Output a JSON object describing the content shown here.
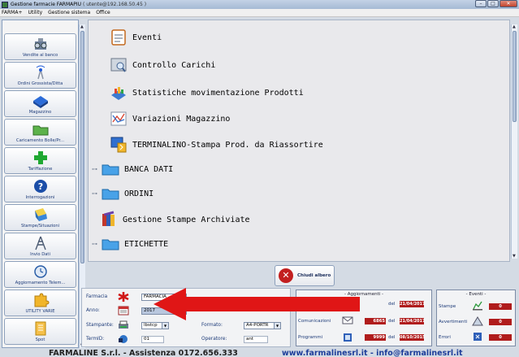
{
  "window": {
    "title": "Gestione farmacie FARMAPIU",
    "title_user": "( utente@192.168.50.45 )",
    "controls": [
      "–",
      "□",
      "✕"
    ]
  },
  "menubar": [
    "FARMA+",
    "Utility",
    "Gestione sistema",
    "Office"
  ],
  "sidebar": {
    "items": [
      {
        "label": "Vendite al banco",
        "icon": "cash-register-icon"
      },
      {
        "label": "Ordini Grossista/Ditta",
        "icon": "wifi-tower-icon"
      },
      {
        "label": "Magazzino",
        "icon": "warehouse-icon"
      },
      {
        "label": "Caricamento Bolle/Pr...",
        "icon": "folder-icon"
      },
      {
        "label": "Tariffazione",
        "icon": "green-cross-icon"
      },
      {
        "label": "Interrogazioni",
        "icon": "question-icon"
      },
      {
        "label": "Stampe/Situazioni",
        "icon": "printer-icon"
      },
      {
        "label": "Invio Dati",
        "icon": "antenna-icon"
      },
      {
        "label": "Aggiornamento Telem...",
        "icon": "clock-icon"
      },
      {
        "label": "UTILITY VARIE",
        "icon": "puzzle-icon"
      },
      {
        "label": "Spot",
        "icon": "document-icon"
      }
    ]
  },
  "tree": {
    "items": [
      {
        "label": "Eventi",
        "icon": "notepad-icon",
        "level": 1
      },
      {
        "label": "Controllo Carichi",
        "icon": "search-document-icon",
        "level": 1
      },
      {
        "label": "Statistiche movimentazione Prodotti",
        "icon": "stats-icon",
        "level": 1
      },
      {
        "label": "Variazioni Magazzino",
        "icon": "chart-line-icon",
        "level": 1
      },
      {
        "label": "TERMINALINO-Stampa Prod. da Riassortire",
        "icon": "terminal-icon",
        "level": 1
      },
      {
        "label": "BANCA DATI",
        "icon": "folder-icon",
        "level": 0
      },
      {
        "label": "ORDINI",
        "icon": "folder-icon",
        "level": 0
      },
      {
        "label": "Gestione Stampe Archiviate",
        "icon": "books-icon",
        "level": 0
      },
      {
        "label": "ETICHETTE",
        "icon": "folder-icon",
        "level": 0
      }
    ]
  },
  "chiudi": {
    "label": "Chiudi albero"
  },
  "config": {
    "farmacia_label": "Farmacia",
    "farmacia_value": "FARMACIA",
    "anno_label": "Anno:",
    "anno_value": "2017",
    "stampante_label": "Stampante:",
    "stampante_value": "lbstcp",
    "formato_label": "Formato:",
    "formato_value": "A4-PORTR",
    "terminale_label": "TermID:",
    "terminale_value": "01",
    "operatore_label": "Operatore:",
    "operatore_value": "ant"
  },
  "aggiornamenti": {
    "title": "- Aggiornamenti -",
    "rows": [
      {
        "label": "",
        "num": "",
        "del": "del",
        "date": "21/04/2017"
      },
      {
        "label": "Comunicazioni",
        "num": "6865",
        "del": "del",
        "date": "21/04/2017"
      },
      {
        "label": "Programmi",
        "num": "9999",
        "del": "del",
        "date": "08/10/2015"
      }
    ]
  },
  "eventi": {
    "title": "- Eventi -",
    "rows": [
      {
        "label": "Stampe",
        "num": "0"
      },
      {
        "label": "Avvertimenti",
        "num": "0"
      },
      {
        "label": "Errori",
        "num": "0"
      }
    ]
  },
  "footer": {
    "left": "FARMALINE S.r.l. - Assistenza 0172.656.333",
    "right": "www.farmalinesrl.it - info@farmalinesrl.it"
  },
  "colors": {
    "accent_blue": "#1c3a78",
    "alert_red": "#b01c1c",
    "arrow_red": "#e01616"
  }
}
